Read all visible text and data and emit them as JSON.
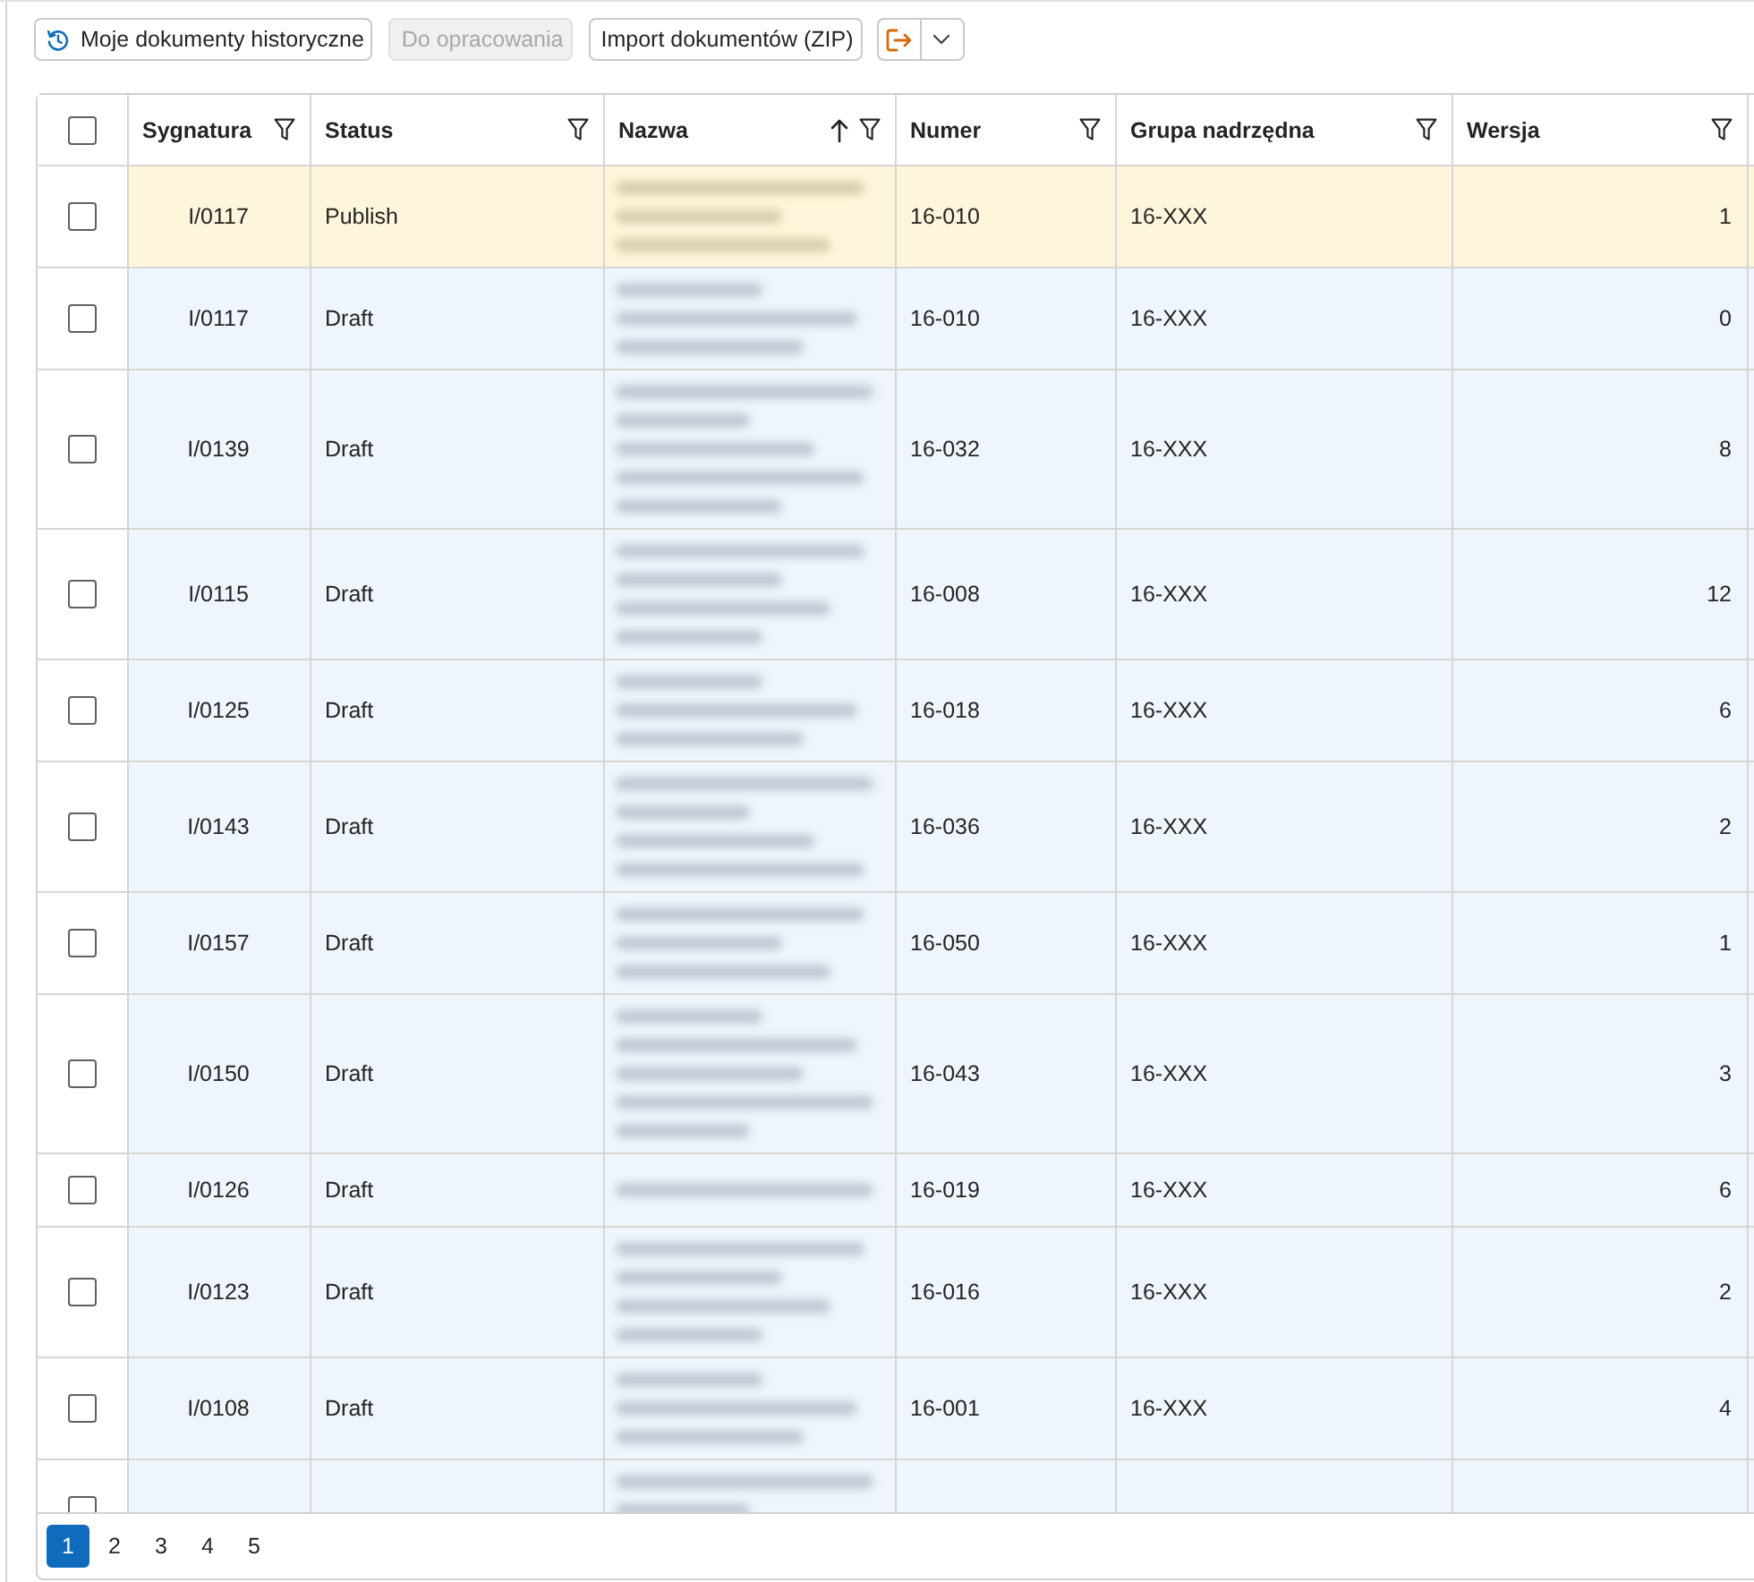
{
  "toolbar": {
    "buttons": [
      {
        "kind": "icon-text",
        "label": "Moje dokumenty historyczne",
        "disabled": false
      },
      {
        "kind": "text",
        "label": "Do opracowania",
        "disabled": true
      },
      {
        "kind": "text",
        "label": "Import dokumentów (ZIP)",
        "disabled": false
      },
      {
        "kind": "split",
        "disabled": false
      }
    ]
  },
  "table": {
    "select_all": {
      "checked": false
    },
    "columns": [
      {
        "label": "Sygnatura",
        "sorted": false
      },
      {
        "label": "Status",
        "sorted": false
      },
      {
        "label": "Nazwa",
        "sorted": true
      },
      {
        "label": "Numer",
        "sorted": false
      },
      {
        "label": "Grupa nadrzędna",
        "sorted": false
      },
      {
        "label": "Wersja",
        "sorted": false
      }
    ],
    "rows": [
      {
        "checked": false,
        "highlighted": true,
        "sygnatura": "I/0117",
        "status": "Publish",
        "numer": "16-010",
        "grupa_nadrzedna": "16-XXX",
        "wersja": "1"
      },
      {
        "checked": false,
        "highlighted": false,
        "sygnatura": "I/0117",
        "status": "Draft",
        "numer": "16-010",
        "grupa_nadrzedna": "16-XXX",
        "wersja": "0"
      },
      {
        "checked": false,
        "highlighted": false,
        "sygnatura": "I/0139",
        "status": "Draft",
        "numer": "16-032",
        "grupa_nadrzedna": "16-XXX",
        "wersja": "8"
      },
      {
        "checked": false,
        "highlighted": false,
        "sygnatura": "I/0115",
        "status": "Draft",
        "numer": "16-008",
        "grupa_nadrzedna": "16-XXX",
        "wersja": "12"
      },
      {
        "checked": false,
        "highlighted": false,
        "sygnatura": "I/0125",
        "status": "Draft",
        "numer": "16-018",
        "grupa_nadrzedna": "16-XXX",
        "wersja": "6"
      },
      {
        "checked": false,
        "highlighted": false,
        "sygnatura": "I/0143",
        "status": "Draft",
        "numer": "16-036",
        "grupa_nadrzedna": "16-XXX",
        "wersja": "2"
      },
      {
        "checked": false,
        "highlighted": false,
        "sygnatura": "I/0157",
        "status": "Draft",
        "numer": "16-050",
        "grupa_nadrzedna": "16-XXX",
        "wersja": "1"
      },
      {
        "checked": false,
        "highlighted": false,
        "sygnatura": "I/0150",
        "status": "Draft",
        "numer": "16-043",
        "grupa_nadrzedna": "16-XXX",
        "wersja": "3"
      },
      {
        "checked": false,
        "highlighted": false,
        "sygnatura": "I/0126",
        "status": "Draft",
        "numer": "16-019",
        "grupa_nadrzedna": "16-XXX",
        "wersja": "6"
      },
      {
        "checked": false,
        "highlighted": false,
        "sygnatura": "I/0123",
        "status": "Draft",
        "numer": "16-016",
        "grupa_nadrzedna": "16-XXX",
        "wersja": "2"
      },
      {
        "checked": false,
        "highlighted": false,
        "sygnatura": "I/0108",
        "status": "Draft",
        "numer": "16-001",
        "grupa_nadrzedna": "16-XXX",
        "wersja": "4"
      },
      {
        "checked": false,
        "highlighted": false
      }
    ]
  },
  "pagination": {
    "pages": [
      {
        "label": "1",
        "selected": true
      },
      {
        "label": "2",
        "selected": false
      },
      {
        "label": "3",
        "selected": false
      },
      {
        "label": "4",
        "selected": false
      },
      {
        "label": "5",
        "selected": false
      }
    ]
  }
}
